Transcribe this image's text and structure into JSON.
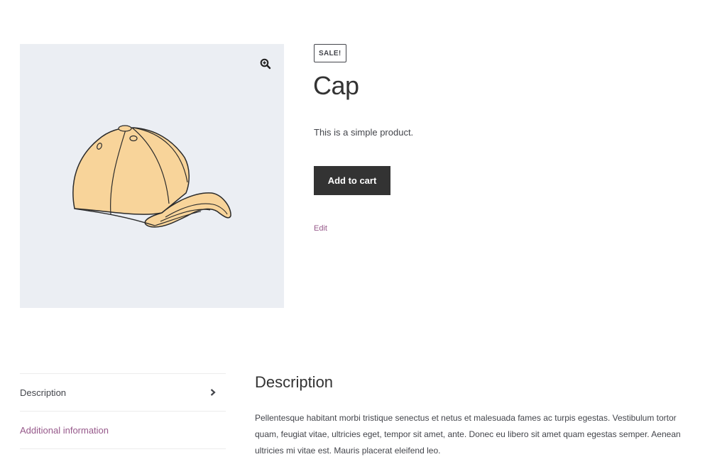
{
  "product": {
    "badge": "SALE!",
    "title": "Cap",
    "short_description": "This is a simple product.",
    "add_to_cart_label": "Add to cart",
    "edit_label": "Edit",
    "image_alt": "Cap"
  },
  "tabs": [
    {
      "label": "Description",
      "active": true
    },
    {
      "label": "Additional information",
      "active": false
    }
  ],
  "description_panel": {
    "heading": "Description",
    "body": "Pellentesque habitant morbi tristique senectus et netus et malesuada fames ac turpis egestas. Vestibulum tortor quam, feugiat vitae, ultricies eget, tempor sit amet, ante. Donec eu libero sit amet quam egestas semper. Aenean ultricies mi vitae est. Mauris placerat eleifend leo."
  },
  "colors": {
    "accent": "#96588a",
    "button_bg": "#333333",
    "gallery_bg": "#ebeef3",
    "text": "#43454b"
  },
  "icons": {
    "zoom": "zoom-in-magnifier",
    "tab_arrow": "chevron-right"
  }
}
